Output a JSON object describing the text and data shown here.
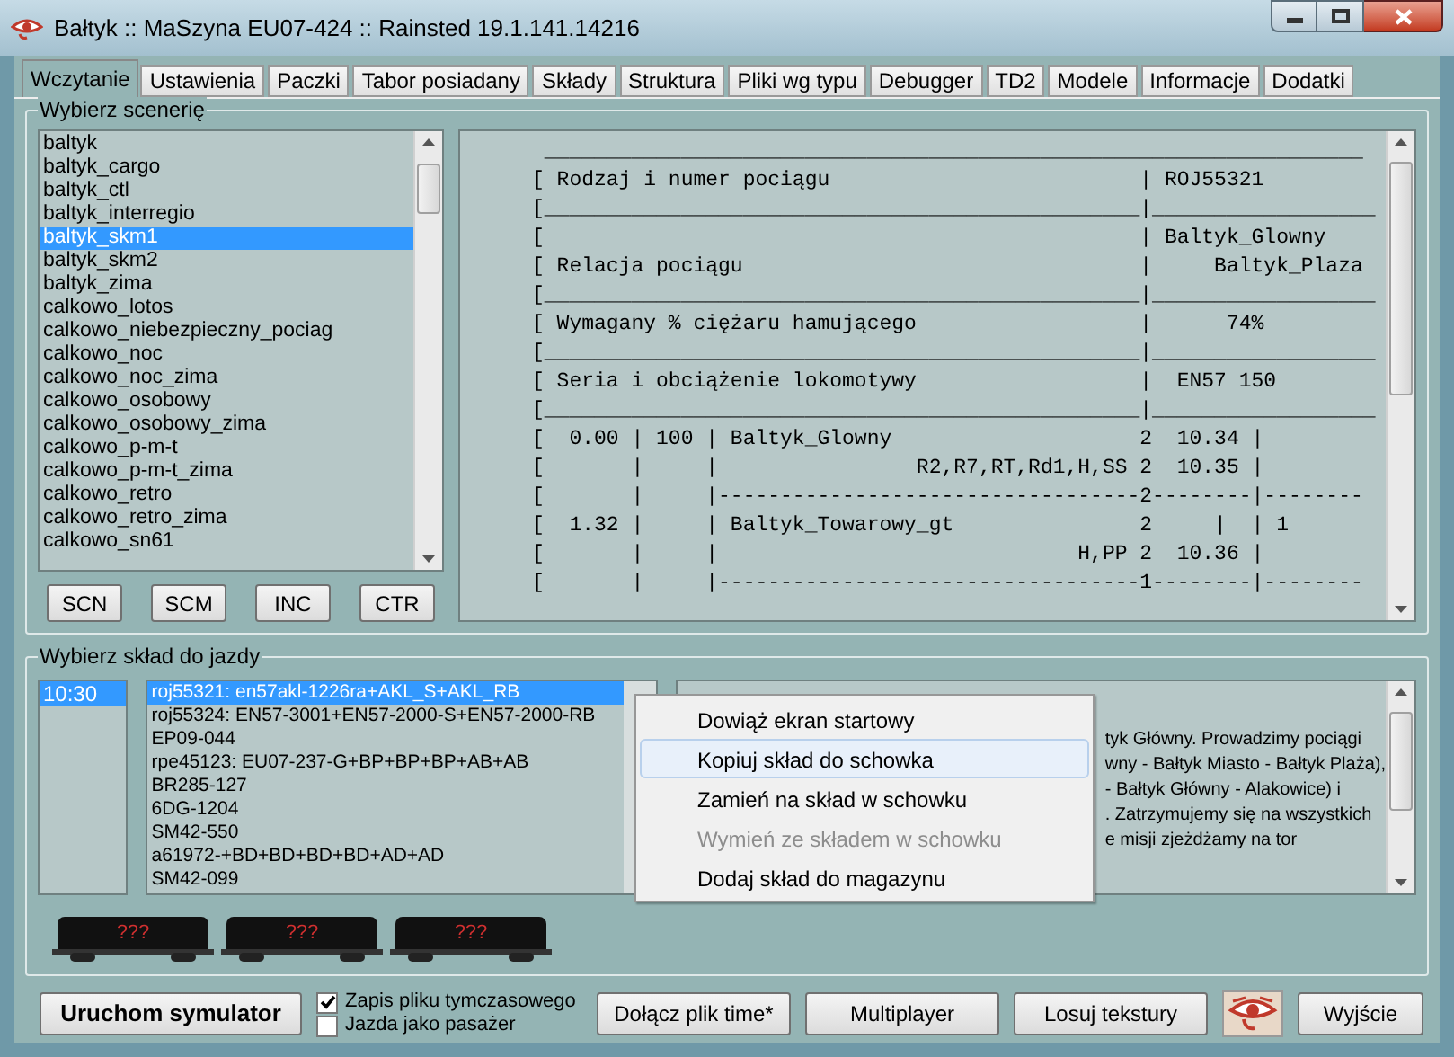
{
  "window": {
    "title": "Bałtyk :: MaSzyna EU07-424 :: Rainsted 19.1.141.14216"
  },
  "tabs": [
    {
      "label": "Wczytanie",
      "selected": true
    },
    {
      "label": "Ustawienia",
      "selected": false
    },
    {
      "label": "Paczki",
      "selected": false
    },
    {
      "label": "Tabor posiadany",
      "selected": false
    },
    {
      "label": "Składy",
      "selected": false
    },
    {
      "label": "Struktura",
      "selected": false
    },
    {
      "label": "Pliki wg typu",
      "selected": false
    },
    {
      "label": "Debugger",
      "selected": false
    },
    {
      "label": "TD2",
      "selected": false
    },
    {
      "label": "Modele",
      "selected": false
    },
    {
      "label": "Informacje",
      "selected": false
    },
    {
      "label": "Dodatki",
      "selected": false
    }
  ],
  "scenery_group": {
    "title": "Wybierz scenerię",
    "items": [
      {
        "label": "baltyk",
        "selected": false
      },
      {
        "label": "baltyk_cargo",
        "selected": false
      },
      {
        "label": "baltyk_ctl",
        "selected": false
      },
      {
        "label": "baltyk_interregio",
        "selected": false
      },
      {
        "label": "baltyk_skm1",
        "selected": true
      },
      {
        "label": "baltyk_skm2",
        "selected": false
      },
      {
        "label": "baltyk_zima",
        "selected": false
      },
      {
        "label": "calkowo_lotos",
        "selected": false
      },
      {
        "label": "calkowo_niebezpieczny_pociag",
        "selected": false
      },
      {
        "label": "calkowo_noc",
        "selected": false
      },
      {
        "label": "calkowo_noc_zima",
        "selected": false
      },
      {
        "label": "calkowo_osobowy",
        "selected": false
      },
      {
        "label": "calkowo_osobowy_zima",
        "selected": false
      },
      {
        "label": "calkowo_p-m-t",
        "selected": false
      },
      {
        "label": "calkowo_p-m-t_zima",
        "selected": false
      },
      {
        "label": "calkowo_retro",
        "selected": false
      },
      {
        "label": "calkowo_retro_zima",
        "selected": false
      },
      {
        "label": "calkowo_sn61",
        "selected": false
      }
    ],
    "buttons": [
      "SCN",
      "SCM",
      "INC",
      "CTR"
    ],
    "timetable_lines": [
      " __________________________________________________________________",
      "[ Rodzaj i numer pociągu                         | ROJ55321",
      "[________________________________________________|__________________",
      "[                                                | Baltyk_Glowny",
      "[ Relacja pociągu                                |     Baltyk_Plaza",
      "[________________________________________________|__________________",
      "[ Wymagany % ciężaru hamującego                  |      74%",
      "[________________________________________________|__________________",
      "[ Seria i obciążenie lokomotywy                  |  EN57 150",
      "[________________________________________________|__________________",
      "[  0.00 | 100 | Baltyk_Glowny                    2  10.34 |",
      "[       |     |                R2,R7,RT,Rd1,H,SS 2  10.35 |",
      "[       |     |----------------------------------2--------|--------",
      "[  1.32 |     | Baltyk_Towarowy_gt               2     |  | 1",
      "[       |     |                             H,PP 2  10.36 |",
      "[       |     |----------------------------------1--------|--------"
    ]
  },
  "consist_group": {
    "title": "Wybierz skład do jazdy",
    "times": [
      {
        "label": "10:30",
        "selected": true
      }
    ],
    "consists": [
      {
        "label": "roj55321: en57akl-1226ra+AKL_S+AKL_RB",
        "selected": true
      },
      {
        "label": "roj55324: EN57-3001+EN57-2000-S+EN57-2000-RB",
        "selected": false
      },
      {
        "label": "EP09-044",
        "selected": false
      },
      {
        "label": "rpe45123: EU07-237-G+BP+BP+BP+AB+AB",
        "selected": false
      },
      {
        "label": "BR285-127",
        "selected": false
      },
      {
        "label": "6DG-1204",
        "selected": false
      },
      {
        "label": "SM42-550",
        "selected": false
      },
      {
        "label": "a61972-+BD+BD+BD+BD+AD+AD",
        "selected": false
      },
      {
        "label": "SM42-099",
        "selected": false
      }
    ],
    "description_lines": [
      "tyk Główny. Prowadzimy pociągi",
      "wny - Bałtyk Miasto - Bałtyk Plaża),",
      "- Bałtyk Główny - Alakowice) i",
      ". Zatrzymujemy się na wszystkich",
      "e misji zjeżdżamy na tor"
    ],
    "wagons": [
      {
        "label": "???"
      },
      {
        "label": "???"
      },
      {
        "label": "???"
      }
    ]
  },
  "context_menu": [
    {
      "label": "Dowiąż ekran startowy",
      "selected": false,
      "disabled": false
    },
    {
      "label": "Kopiuj skład do schowka",
      "selected": true,
      "disabled": false
    },
    {
      "label": "Zamień na skład w schowku",
      "selected": false,
      "disabled": false
    },
    {
      "label": "Wymień ze składem w schowku",
      "selected": false,
      "disabled": true
    },
    {
      "label": "Dodaj skład do magazynu",
      "selected": false,
      "disabled": false
    }
  ],
  "bottom_bar": {
    "start_button": "Uruchom symulator",
    "checkboxes": [
      {
        "label": "Zapis pliku tymczasowego",
        "checked": true
      },
      {
        "label": "Jazda jako pasażer",
        "checked": false
      }
    ],
    "buttons": [
      "Dołącz plik time*",
      "Multiplayer",
      "Losuj tekstury"
    ],
    "exit_button": "Wyjście"
  }
}
